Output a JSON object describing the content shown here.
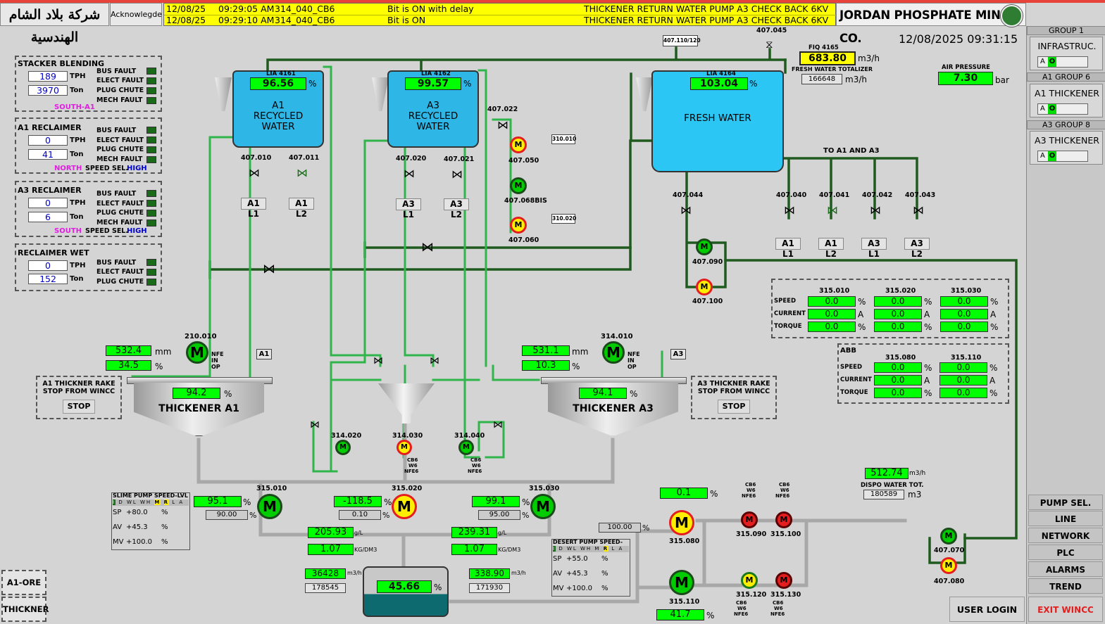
{
  "header": {
    "company_arabic": "شركة بلاد الشام الهندسية",
    "acknowledge": "Acknowlegde",
    "company": "JORDAN PHOSPHATE MINES CO.",
    "datetime": "12/08/2025 09:31:15"
  },
  "alarms": [
    {
      "date": "12/08/25",
      "time": "09:29:05 AM",
      "tag": "314_040_CB6",
      "state": "Bit is ON with delay",
      "message": "THICKENER RETURN WATER PUMP A3 CHECK BACK 6KV"
    },
    {
      "date": "12/08/25",
      "time": "09:29:10 AM",
      "tag": "314_040_CB6",
      "state": "Bit is ON",
      "message": "THICKENER RETURN WATER PUMP A3 CHECK BACK 6KV"
    }
  ],
  "colors": {
    "running": "#00cc00",
    "standby": "#ffee00",
    "fault": "#ee1111",
    "value_bg": "#00ff00",
    "tank_water": "#2eb6e6",
    "pipe_green": "#2fb54a",
    "pipe_dark": "#1f5a1f",
    "alarm_bg": "#ffff00"
  },
  "groups": [
    {
      "title": "GROUP 1",
      "label": "INFRASTRUC.",
      "mode": "A",
      "state": "O"
    },
    {
      "title": "A1 GROUP 6",
      "label": "A1 THICKENER",
      "mode": "A",
      "state": "O"
    },
    {
      "title": "A3 GROUP 8",
      "label": "A3 THICKENER",
      "mode": "A",
      "state": "O"
    }
  ],
  "nav": [
    "PUMP SEL.",
    "LINE SELECTION",
    "NETWORK",
    "PLC",
    "ALARMS",
    "TREND"
  ],
  "user_login": "USER LOGIN",
  "exit": "EXIT WINCC",
  "bottom_left": [
    "A1-ORE",
    "THICKNER"
  ],
  "left_panels": {
    "stacker": {
      "title": "STACKER BLENDING",
      "tph": "189",
      "ton": "3970",
      "faults": [
        "BUS FAULT",
        "ELECT FAULT",
        "PLUG CHUTE",
        "MECH FAULT"
      ],
      "source": "SOUTH-A1"
    },
    "a1rec": {
      "title": "A1 RECLAIMER",
      "tph": "0",
      "ton": "41",
      "faults": [
        "BUS FAULT",
        "ELECT FAULT",
        "PLUG CHUTE",
        "MECH FAULT"
      ],
      "source": "NORTH",
      "speed_sel": "SPEED SEL.",
      "speed_val": "HIGH"
    },
    "a3rec": {
      "title": "A3 RECLAIMER",
      "tph": "0",
      "ton": "6",
      "faults": [
        "BUS FAULT",
        "ELECT FAULT",
        "PLUG CHUTE",
        "MECH FAULT"
      ],
      "source": "SOUTH",
      "speed_sel": "SPEED SEL.",
      "speed_val": "HIGH"
    },
    "wet": {
      "title": "RECLAIMER WET",
      "tph": "0",
      "ton": "152",
      "faults": [
        "BUS FAULT",
        "ELECT FAULT",
        "PLUG CHUTE"
      ]
    },
    "units": {
      "tph": "TPH",
      "ton": "Ton"
    }
  },
  "tanks": {
    "a1": {
      "lia": "LIA 4161",
      "level": "96.56",
      "name": "A1\nRECYCLED\nWATER"
    },
    "a3": {
      "lia": "LIA 4162",
      "level": "99.57",
      "name": "A3\nRECYCLED\nWATER"
    },
    "fw": {
      "lia": "LIA 4164",
      "level": "103.04",
      "name": "FRESH WATER"
    }
  },
  "fiq": {
    "tag": "FIQ 4165",
    "value": "683.80",
    "unit": "m3/h",
    "totalizer_label": "FRESH WATER TOTALIZER",
    "totalizer": "166648",
    "tot_unit": "m3/h"
  },
  "air": {
    "label": "AIR PRESSURE",
    "value": "7.30",
    "unit": "bar"
  },
  "valves": {
    "v407010": "407.010",
    "v407011": "407.011",
    "v407020": "407.020",
    "v407021": "407.021",
    "v407022": "407.022",
    "v407044": "407.044",
    "v407045": "407.045",
    "v407040": "407.040",
    "v407041": "407.041",
    "v407042": "407.042",
    "v407043": "407.043",
    "box407110": "407.110/120",
    "box310010": "310.010",
    "box310020": "310.020"
  },
  "lines": {
    "a1l1": "A1 L1",
    "a1l2": "A1 L2",
    "a3l1": "A3 L1",
    "a3l2": "A3 L2",
    "to_a1a3": "TO A1 AND A3"
  },
  "pumps": {
    "p407050": "407.050",
    "p407068": "407.068BIS",
    "p407060": "407.060",
    "p407090": "407.090",
    "p407100": "407.100",
    "p407070": "407.070",
    "p407080": "407.080",
    "p314020": "314.020",
    "p314030": "314.030",
    "p314040": "314.040",
    "p315080": "315.080",
    "p315090": "315.090",
    "p315100": "315.100",
    "p315110": "315.110",
    "p315120": "315.120",
    "p315130": "315.130",
    "p315010": "315.010",
    "p315020": "315.020",
    "p315030": "315.030"
  },
  "motor_letter": "M",
  "interlock": {
    "nfe": "NFE",
    "in": "IN",
    "op": "OP",
    "cb6": "CB6",
    "w6": "W6",
    "nfe6": "NFE6"
  },
  "thickener_a1": {
    "tag": "210.010",
    "mm": "532.4",
    "pct": "34.5",
    "level": "94.2",
    "name": "THICKENER A1",
    "box": "A1",
    "rake_msg": "A1 THICKNER RAKE\nSTOP FROM WINCC",
    "stop": "STOP"
  },
  "thickener_a3": {
    "tag": "314.010",
    "mm": "531.1",
    "pct": "10.3",
    "level": "94.1",
    "name": "THICKENER A3",
    "box": "A3",
    "rake_msg": "A3 THICKNER RAKE\nSTOP FROM WINCC",
    "stop": "STOP"
  },
  "units": {
    "mm": "mm",
    "pct": "%",
    "amp": "A",
    "m3h": "m3/h",
    "m3": "m3",
    "gl": "g/L",
    "kgdm3": "KG/DM3"
  },
  "speeds": {
    "headers": [
      "315.010",
      "315.020",
      "315.030"
    ],
    "rows": [
      "SPEED",
      "CURRENT",
      "TORQUE"
    ],
    "values": [
      [
        "0.0",
        "0.0",
        "0.0"
      ],
      [
        "0.0",
        "0.0",
        "0.0"
      ],
      [
        "0.0",
        "0.0",
        "0.0"
      ]
    ],
    "units": [
      "%",
      "A",
      "%"
    ],
    "abb_title": "ABB",
    "abb_headers": [
      "315.080",
      "315.110"
    ],
    "abb_values": [
      [
        "0.0",
        "0.0"
      ],
      [
        "0.0",
        "0.0"
      ],
      [
        "0.0",
        "0.0"
      ]
    ]
  },
  "slime": {
    "title": "SLIME PUMP SPEED-LVL",
    "status": [
      "I",
      "D",
      "WL",
      "WH",
      "M",
      "R",
      "L",
      "A"
    ],
    "sp": "+80.0",
    "av": "+45.3",
    "mv": "+100.0",
    "labels": [
      "SP",
      "AV",
      "MV"
    ],
    "unit": "%"
  },
  "desert": {
    "title": "DESERT PUMP SPEED-LVL",
    "status": [
      "I",
      "D",
      "WL",
      "WH",
      "M",
      "R",
      "L",
      "A"
    ],
    "sp": "+55.0",
    "av": "+45.3",
    "mv": "+100.0",
    "labels": [
      "SP",
      "AV",
      "MV"
    ],
    "unit": "%"
  },
  "slime_pumps": {
    "p010_val": "95.1",
    "p010_set": "90.00",
    "p020_val": "-118.5",
    "p020_set": "0.10",
    "p030_val": "99.1",
    "p030_set": "95.00",
    "density1": "205.93",
    "density2": "239.31",
    "kg1": "1.07",
    "kg2": "1.07",
    "flow1": "36428",
    "tot1": "178545",
    "flow2": "338.90",
    "tot2": "171930",
    "sump_level": "45.66"
  },
  "desert_pumps": {
    "top_val": "0.1",
    "set": "100.00",
    "bottom_val": "41.7"
  },
  "dispo": {
    "value": "512.74",
    "unit": "m3/h",
    "label": "DISPO WATER TOT.",
    "tot": "180589",
    "tot_unit": "m3"
  }
}
